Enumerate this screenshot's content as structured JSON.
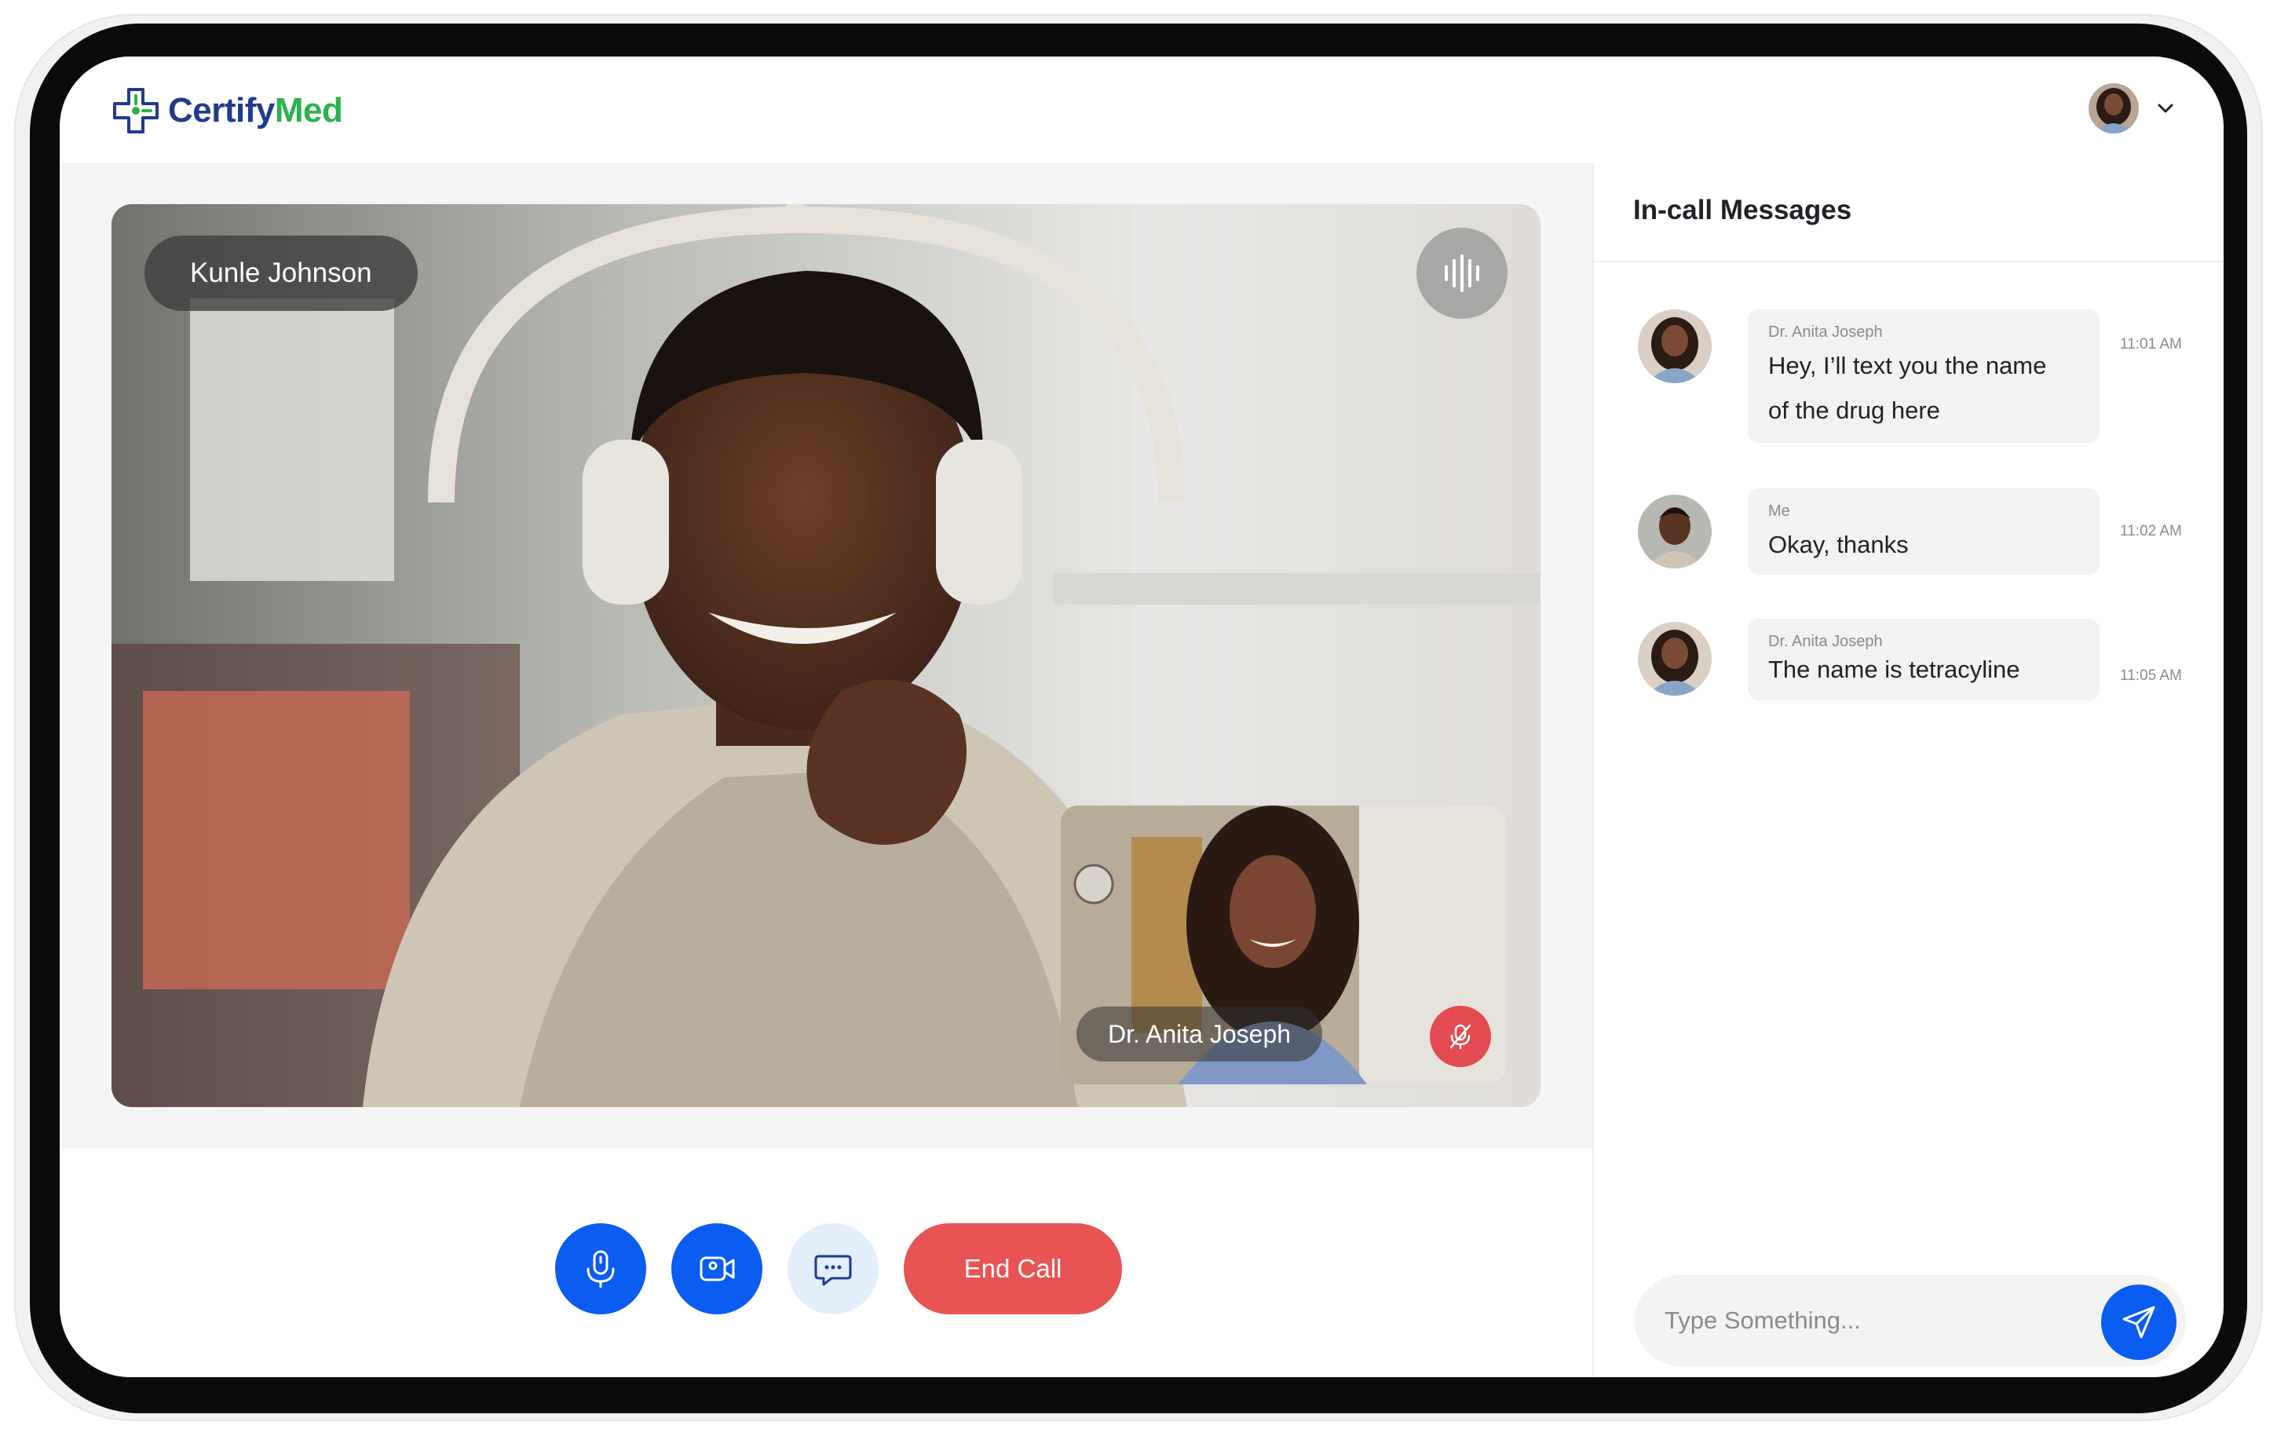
{
  "app": {
    "logo_part1": "Certify",
    "logo_part2": "Med",
    "brand_blue": "#1f3b8c",
    "brand_green": "#2bb24c"
  },
  "header": {
    "profile_icon": "user-avatar",
    "dropdown_icon": "chevron-down-icon"
  },
  "call": {
    "remote_participant": "Kunle Johnson",
    "self_participant": "Dr. Anita Joseph",
    "speaking_icon": "audio-wave-icon",
    "self_muted_icon": "mic-off-icon"
  },
  "controls": {
    "mic_icon": "microphone-icon",
    "camera_icon": "video-camera-icon",
    "chat_icon": "chat-bubble-icon",
    "end_call_label": "End Call",
    "end_call_color": "#e85454",
    "accent_color": "#0b5cf0"
  },
  "chat": {
    "title": "In-call Messages",
    "messages": [
      {
        "sender": "Dr. Anita Joseph",
        "line1": "Hey, I’ll text you the name",
        "line2": "of the drug here",
        "time": "11:01 AM"
      },
      {
        "sender": "Me",
        "line1": "Okay, thanks",
        "time": "11:02 AM"
      },
      {
        "sender": "Dr. Anita Joseph",
        "line1": "The name is tetracyline",
        "time": "11:05 AM"
      }
    ],
    "input_placeholder": "Type Something...",
    "send_icon": "paper-plane-icon"
  }
}
